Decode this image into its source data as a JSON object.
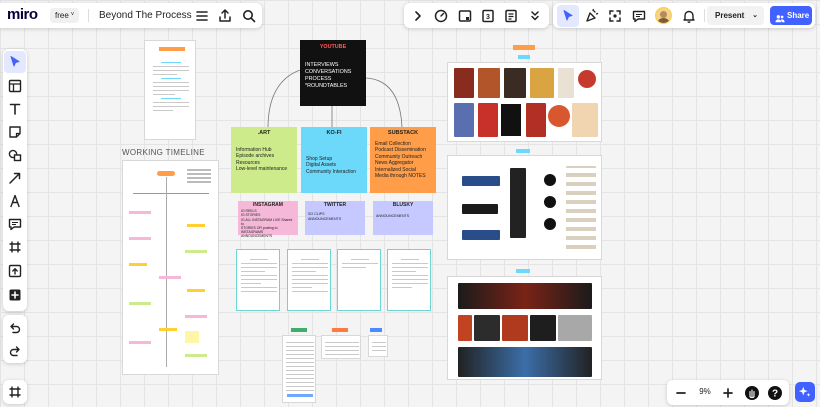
{
  "app": {
    "logo": "miro",
    "plan_badge": "free",
    "board_title": "Beyond The Process"
  },
  "topbar_right": {
    "present_label": "Present",
    "share_label": "Share"
  },
  "zoom": {
    "level": "9%"
  },
  "canvas": {
    "working_timeline_label": "WORKING TIMELINE",
    "youtube": {
      "header": "YOUTUBE",
      "lines": [
        "INTERVIEWS",
        "CONVERSATIONS",
        "PROCESS",
        "*ROUNDTABLES"
      ]
    },
    "art": {
      "header": ".ART",
      "lines": [
        "Information Hub",
        "Episode archives",
        "Resources",
        "Low-level maintenance"
      ]
    },
    "kofi": {
      "header": "KO-FI",
      "lines": [
        "Shop Setup",
        "Digital Assets",
        "Community Interaction"
      ]
    },
    "substack": {
      "header": "SUBSTACK",
      "lines": [
        "Email Collection",
        "Podcast Dissemination",
        "Community Outreach",
        "News Aggregator",
        "Internalized Social",
        "Media through NOTES"
      ]
    },
    "instagram": {
      "header": "INSTAGRAM",
      "lines": [
        "IG REELS",
        "IG STORIES",
        "IG ALL INSTAGRAM LIVE Shared to",
        "STORIES OR posting to INSTAGRAMS",
        "ANNOUNCEMENTS"
      ]
    },
    "twitter": {
      "header": "TWITTER",
      "lines": [
        "SO CLIPS",
        "ANNOUNCEMENTS"
      ]
    },
    "blusky": {
      "header": "BLUSKY",
      "lines": [
        "ANNOUNCEMENTS"
      ]
    }
  },
  "colors": {
    "miro_yellow": "#ffd02f",
    "share_blue": "#4262ff",
    "sticky_green": "#cdeb8b",
    "sticky_blue": "#6cd8fa",
    "sticky_orange": "#ff9d48",
    "sticky_pink": "#f5b8d8",
    "sticky_lavender": "#c6c9ff",
    "teal_frame": "#6fd4d4"
  },
  "icons": {
    "menu": "hamburger-icon",
    "export": "upload-icon",
    "search": "search-icon",
    "expand": "chevron-right-icon",
    "timer": "timer-icon",
    "presentation": "presentation-icon",
    "counter": "counter-icon",
    "notes": "notes-icon",
    "more": "double-chevron-down-icon",
    "select": "cursor-icon",
    "celebrate": "celebrate-icon",
    "frame": "frame-icon",
    "comment": "comment-icon",
    "bell": "bell-icon",
    "users": "users-icon",
    "table": "table-icon",
    "text": "text-icon",
    "sticky": "sticky-note-icon",
    "shapes": "shapes-icon",
    "pen": "pen-icon",
    "line": "arrow-line-icon",
    "upload": "upload-tool-icon",
    "add": "plus-square-icon",
    "undo": "undo-icon",
    "redo": "redo-icon",
    "minimap": "minimap-icon",
    "zoom_out": "minus-icon",
    "zoom_in": "plus-icon",
    "help": "help-icon",
    "hand": "hand-icon",
    "ai": "sparkle-icon"
  }
}
